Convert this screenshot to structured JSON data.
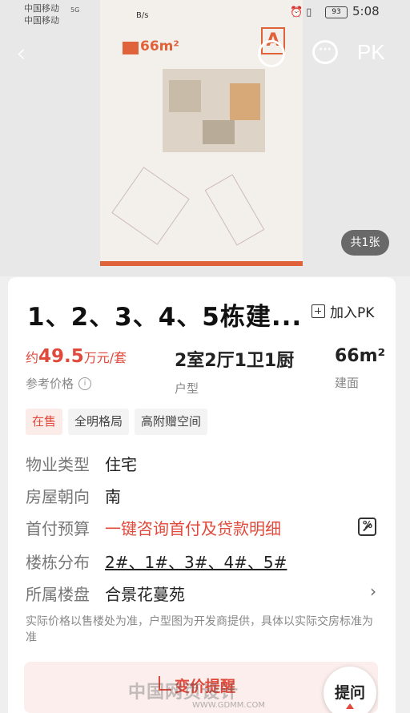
{
  "status_bar": {
    "carrier_1": "中国移动",
    "carrier_2": "中国移动",
    "network": "5G",
    "net_speed": "B/s",
    "battery": "93",
    "time": "5:08"
  },
  "nav": {
    "back_icon": "chevron-left-icon",
    "share_icon": "share-icon",
    "chat_icon": "chat-icon",
    "chat_glyph": "···",
    "pk_label": "PK"
  },
  "floorplan": {
    "area_label": "66m²",
    "unit_badge": "A"
  },
  "gallery": {
    "count_label": "共1张"
  },
  "detail": {
    "title": "1、2、3、4、5栋建...",
    "add_pk_label": "加入PK",
    "price_prefix": "约",
    "price_value": "49.5",
    "price_unit": "万元/套",
    "price_label": "参考价格",
    "layout_value": "2室2厅1卫1厨",
    "layout_label": "户型",
    "area_value": "66m²",
    "area_label": "建面",
    "tags": [
      "在售",
      "全明格局",
      "高附赠空间"
    ],
    "rows": [
      {
        "key": "物业类型",
        "value": "住宅"
      },
      {
        "key": "房屋朝向",
        "value": "南"
      },
      {
        "key": "首付预算",
        "value": "一键咨询首付及贷款明细"
      },
      {
        "key": "楼栋分布",
        "value": "2#、1#、3#、4#、5#"
      },
      {
        "key": "所属楼盘",
        "value": "合景花蔓苑"
      }
    ],
    "note": "实际价格以售楼处为准，户型图为开发商提供，具体以实际交房标准为准",
    "price_alert_label": "变价提醒",
    "ask_label": "提问"
  },
  "watermark": {
    "text": "中国网页设计",
    "url": "WWW.GDMM.COM"
  },
  "colors": {
    "accent": "#e04a3c",
    "plan_orange": "#e0623b"
  }
}
